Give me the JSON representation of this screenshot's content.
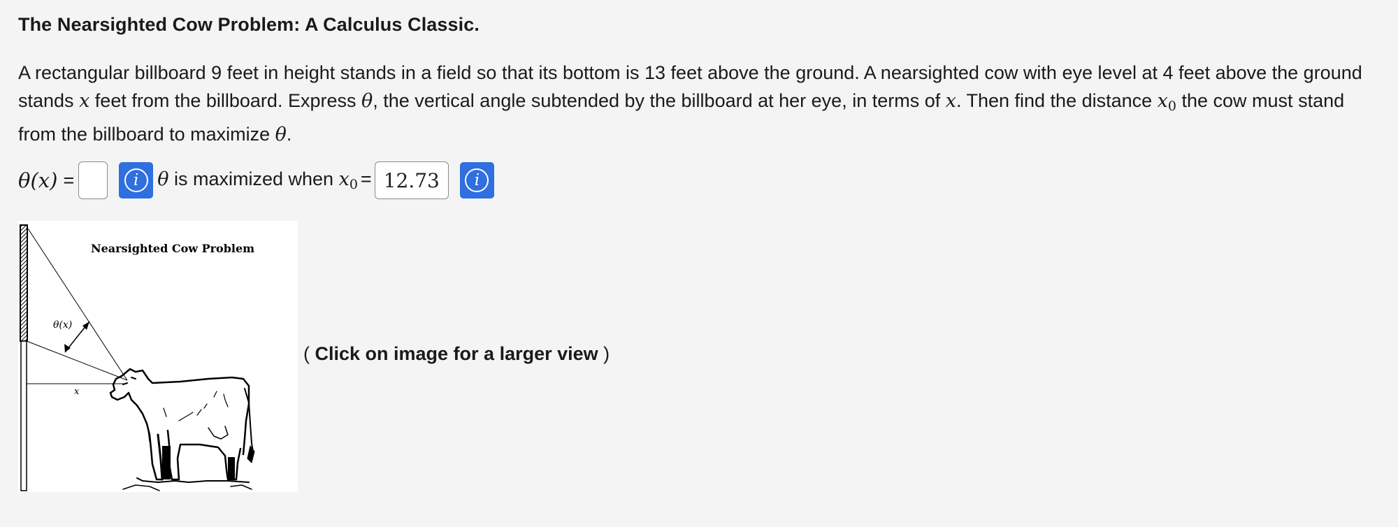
{
  "title": "The Nearsighted Cow Problem: A Calculus Classic.",
  "problem": {
    "t1": "A rectangular billboard 9 feet in height stands in a field so that its bottom is 13 feet above the ground. A nearsighted cow with eye level at 4 feet above the ground stands ",
    "var_x": "x",
    "t2": " feet from the billboard. Express ",
    "theta": "θ",
    "t3": ", the vertical angle subtended by the billboard at her eye, in terms of ",
    "var_x2": "x",
    "t4": ". Then find the distance ",
    "x0_base": "x",
    "x0_sub": "0",
    "t5": " the cow must stand from the billboard to maximize ",
    "theta2": "θ",
    "t6": "."
  },
  "answer_row": {
    "lhs": "θ(x)",
    "equals": "=",
    "theta_answer_value": "",
    "info_icon_glyph": "i",
    "statement_theta": "θ",
    "statement_text": " is maximized when ",
    "x0_base": "x",
    "x0_sub": "0",
    "equals2": "=",
    "x0_answer_value": "12.73"
  },
  "figure": {
    "caption": "Nearsighted Cow Problem",
    "angle_label": "θ(x)",
    "distance_label": "x"
  },
  "click_note": {
    "open": "( ",
    "text": "Click on image for a larger view",
    "close": " )"
  },
  "colors": {
    "info_button": "#2f6fdf",
    "page_background": "#f4f4f4"
  }
}
